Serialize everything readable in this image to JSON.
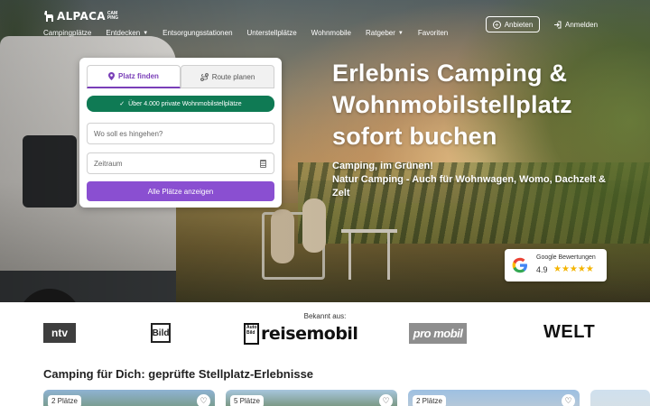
{
  "brand": {
    "name": "ALPACA",
    "sub_top": "CAM",
    "sub_bottom": "PING"
  },
  "nav": {
    "items": [
      "Campingplätze",
      "Entdecken",
      "Entsorgungsstationen",
      "Unterstellplätze",
      "Wohnmobile",
      "Ratgeber",
      "Favoriten"
    ],
    "offer_label": "Anbieten",
    "login_label": "Anmelden"
  },
  "search": {
    "tab_find": "Platz finden",
    "tab_route": "Route planen",
    "badge": "Über 4.000 private Wohnmobilstellplätze",
    "where_placeholder": "Wo soll es hingehen?",
    "when_placeholder": "Zeitraum",
    "submit_label": "Alle Plätze anzeigen"
  },
  "hero": {
    "headline": "Erlebnis Camping & Wohnmobilstellplatz sofort buchen",
    "subline_1": "Camping, im Grünen!",
    "subline_2": "Natur Camping - Auch für Wohnwagen, Womo, Dachzelt & Zelt"
  },
  "google": {
    "label": "Google Bewertungen",
    "rating": "4.9",
    "stars": "★★★★★"
  },
  "press": {
    "label": "Bekannt aus:",
    "ntv": "ntv",
    "bild": "Bild",
    "reise_box": "Auto Bild",
    "reise": "reisemobil",
    "promobil": "pro mobil",
    "welt": "WELT"
  },
  "section": {
    "title": "Camping für Dich: geprüfte Stellplatz-Erlebnisse",
    "tiles": [
      {
        "chip": "2 Plätze"
      },
      {
        "chip": "5 Plätze"
      },
      {
        "chip": "2 Plätze"
      }
    ]
  },
  "colors": {
    "accent": "#8a4fd1",
    "tab_accent": "#7a3fb8",
    "badge_green": "#0f7a54",
    "star": "#f4b400"
  }
}
